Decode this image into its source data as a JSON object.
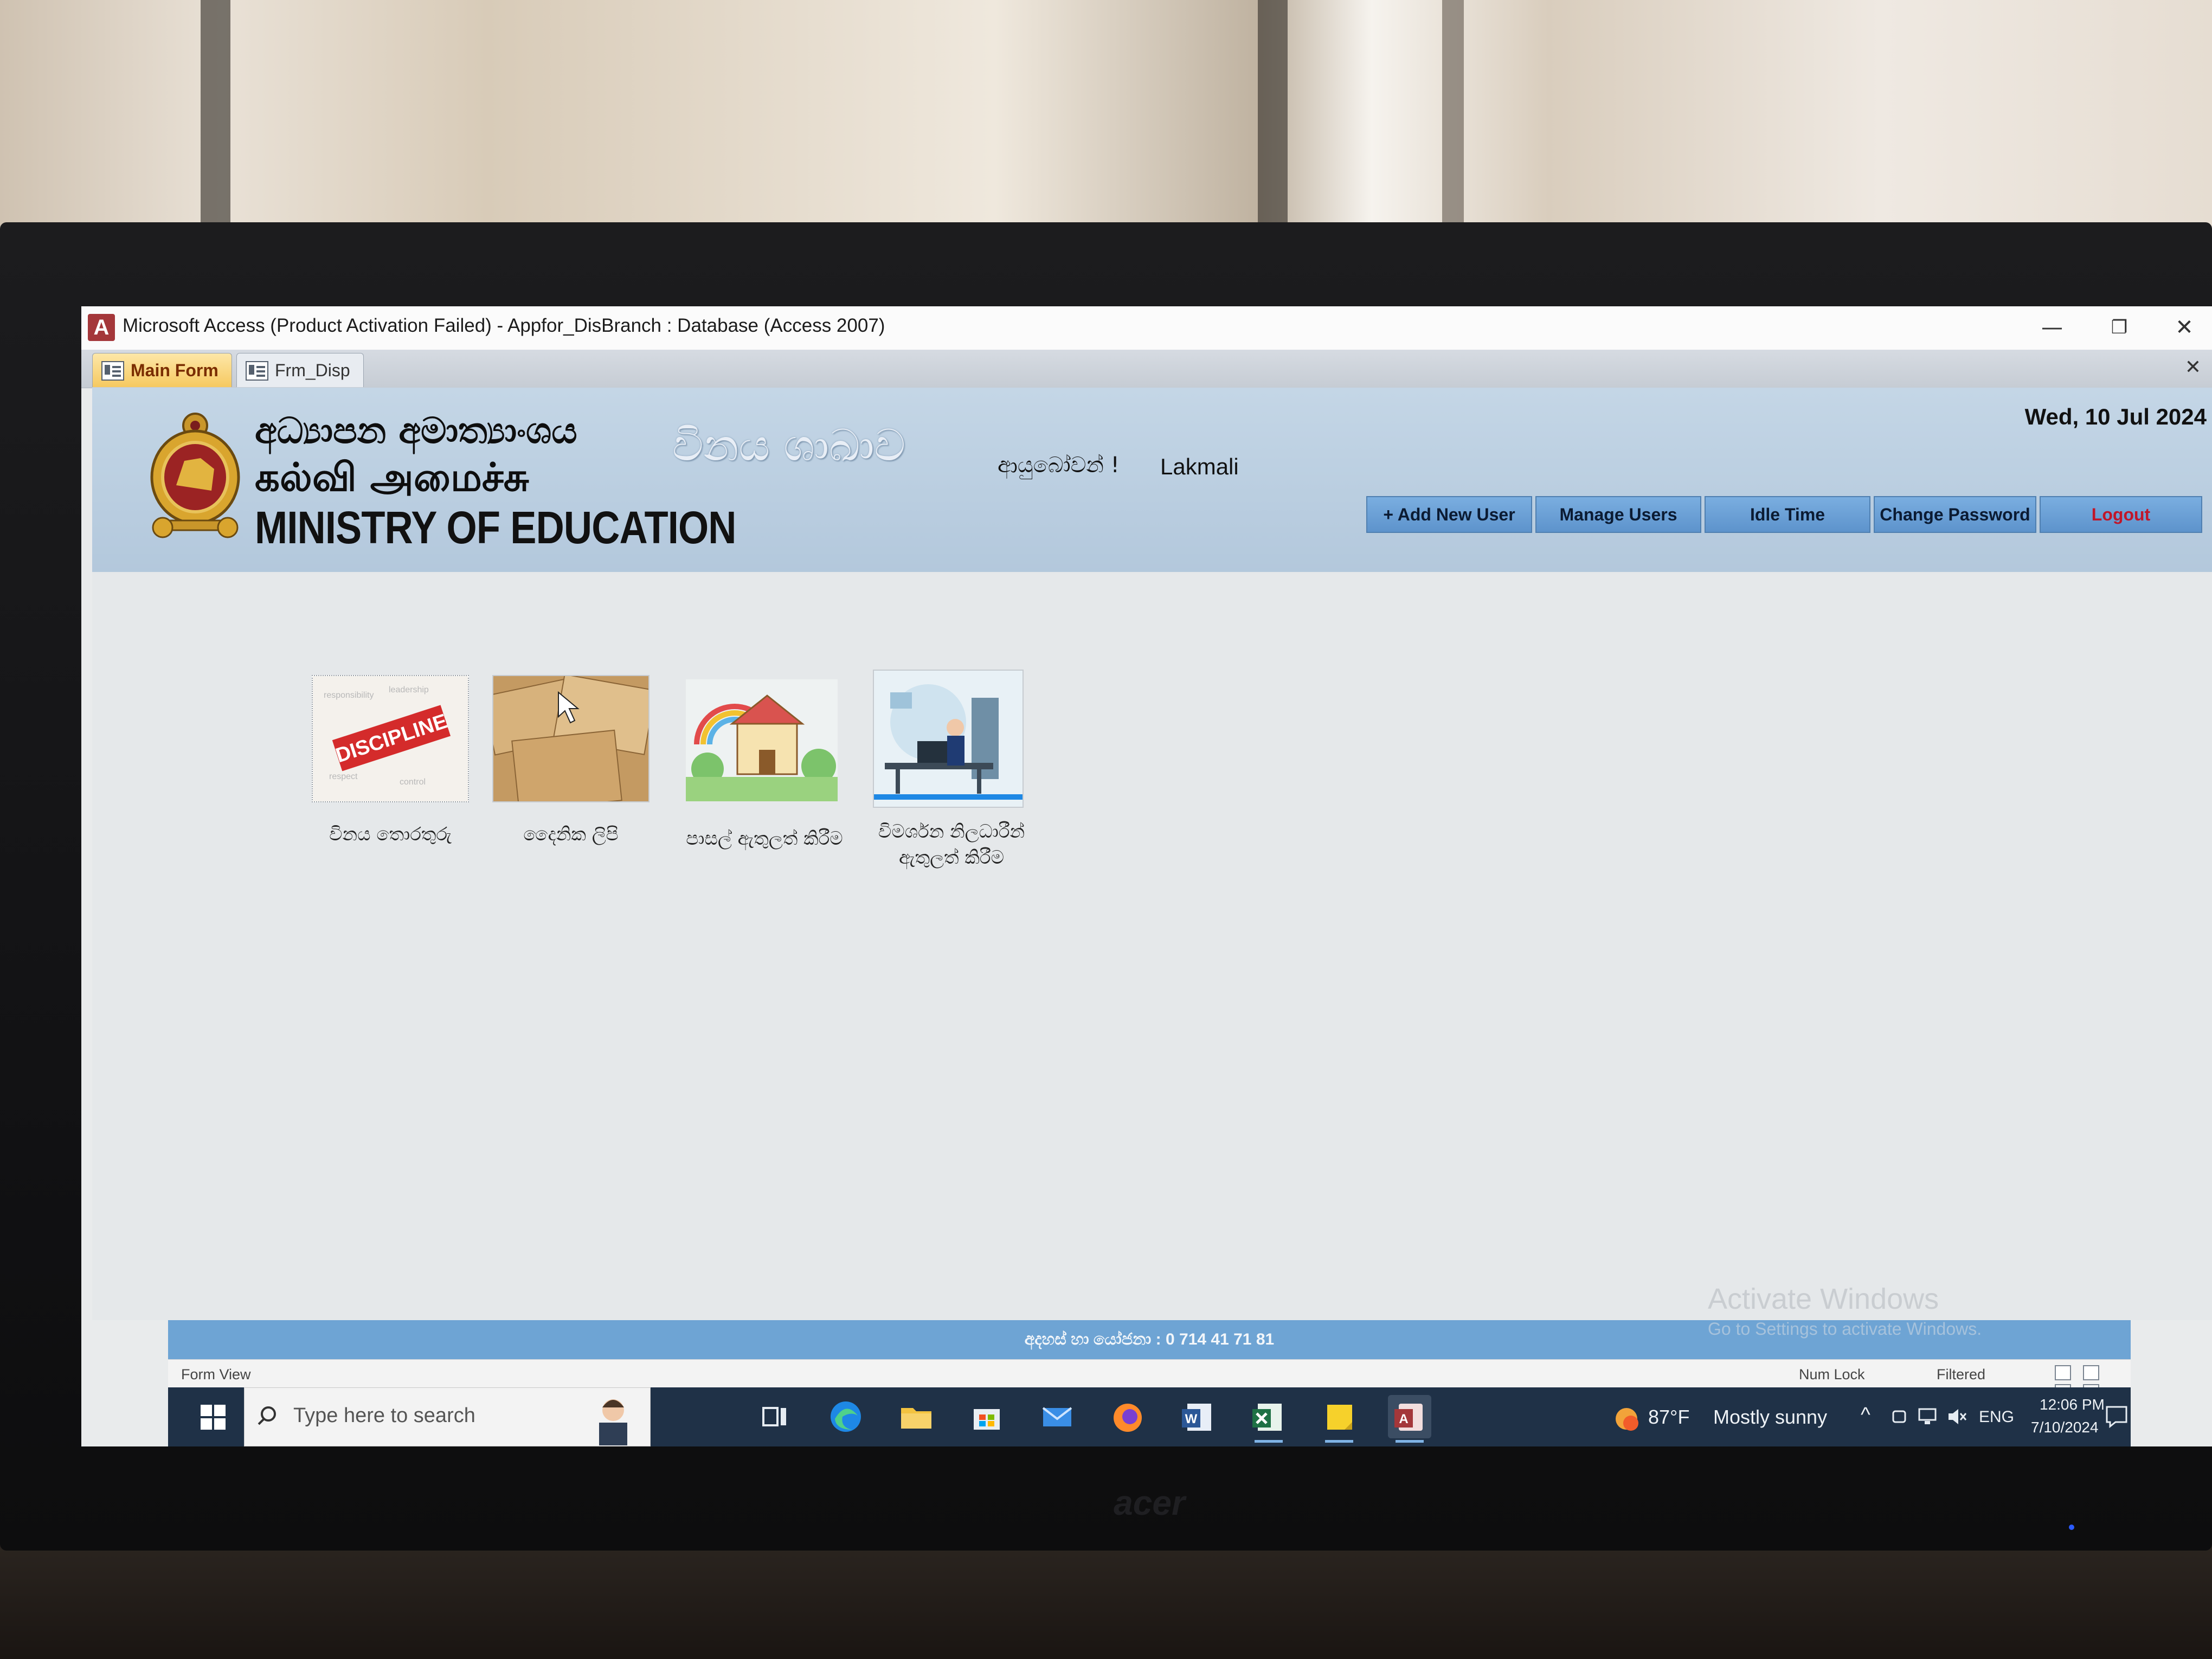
{
  "window": {
    "title": "Microsoft Access (Product Activation Failed) - Appfor_DisBranch : Database (Access 2007)",
    "app_icon_letter": "A",
    "minimize_glyph": "—",
    "restore_glyph": "❐",
    "close_glyph": "✕"
  },
  "tabs": [
    {
      "label": "Main Form",
      "active": true
    },
    {
      "label": "Frm_Disp",
      "active": false
    }
  ],
  "tab_close_glyph": "✕",
  "header": {
    "ministry_sinhala": "අධ්‍යාපන අමාත්‍යාංශය",
    "ministry_tamil": "கல்வி அமைச்சு",
    "ministry_english": "MINISTRY OF EDUCATION",
    "branch_title": "විනය ශාඛාව",
    "welcome": "ආයුබෝවන් !",
    "username": "Lakmali",
    "date": "Wed, 10 Jul 2024",
    "buttons": {
      "add_user": "+ Add New User",
      "manage_users": "Manage Users",
      "idle_time": "Idle Time",
      "change_password": "Change Password",
      "logout": "Logout"
    }
  },
  "tiles": [
    {
      "label": "විනය තොරතුරු",
      "image_text": "DISCIPLINE"
    },
    {
      "label": "දෛනික ලිපි",
      "image_text": ""
    },
    {
      "label": "පාසල් ඇතුලත් කිරීම",
      "image_text": ""
    },
    {
      "label": "විමර්ශන නිලධාරීන් ඇතුලත් කිරීම",
      "image_text": ""
    }
  ],
  "footer_text": "අදහස් හා යෝජනා : 0 714 41 71 81",
  "watermark": {
    "line1": "Activate Windows",
    "line2": "Go to Settings to activate Windows."
  },
  "statusbar": {
    "left": "Form View",
    "num_lock": "Num Lock",
    "filtered": "Filtered"
  },
  "taskbar": {
    "search_placeholder": "Type here to search",
    "weather_temp": "87°F",
    "weather_text": "Mostly sunny",
    "language": "ENG",
    "time": "12:06 PM",
    "date": "7/10/2024",
    "tray_chevron": "^"
  },
  "monitor_brand": "acer",
  "colors": {
    "accent_blue": "#6ea4d4",
    "logout_red": "#c0162a",
    "header_bg": "#c4d6e6",
    "taskbar": "#1f3147"
  }
}
